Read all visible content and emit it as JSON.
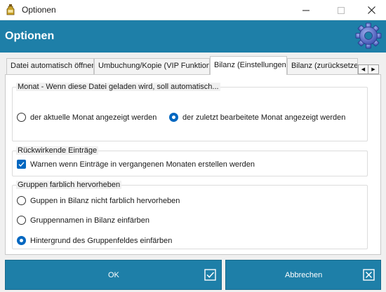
{
  "window": {
    "title": "Optionen",
    "icon": "app-bottle-icon",
    "controls": [
      "minimize-icon",
      "maximize-icon",
      "close-icon"
    ]
  },
  "header": {
    "title": "Optionen",
    "icon": "gear-icon"
  },
  "tabs": [
    {
      "label": "Datei automatisch öffnen",
      "active": false
    },
    {
      "label": "Umbuchung/Kopie (VIP Funktion)",
      "active": false
    },
    {
      "label": "Bilanz (Einstellungen)",
      "active": true
    },
    {
      "label": "Bilanz (zurücksetzen)",
      "active": false
    }
  ],
  "tab_scroll": {
    "left": "◀",
    "right": "▶"
  },
  "groups": {
    "monat": {
      "title": "Monat - Wenn diese Datei geladen wird, soll automatisch...",
      "options": [
        {
          "label": "der aktuelle Monat angezeigt werden",
          "checked": false
        },
        {
          "label": "der zuletzt bearbeitete Monat angezeigt werden",
          "checked": true
        }
      ]
    },
    "rueckwirkend": {
      "title": "Rückwirkende Einträge",
      "checkbox": {
        "label": "Warnen wenn Einträge in vergangenen Monaten erstellen werden",
        "checked": true
      }
    },
    "gruppen": {
      "title": "Gruppen farblich hervorheben",
      "options": [
        {
          "label": "Guppen in Bilanz nicht farblich hervorheben",
          "checked": false
        },
        {
          "label": "Gruppennamen in Bilanz einfärben",
          "checked": false
        },
        {
          "label": "Hintergrund des Gruppenfeldes einfärben",
          "checked": true
        }
      ]
    }
  },
  "buttons": {
    "ok": {
      "label": "OK",
      "icon": "checkbox-check-icon"
    },
    "cancel": {
      "label": "Abbrechen",
      "icon": "checkbox-x-icon"
    }
  },
  "colors": {
    "accent": "#1e7fa8",
    "radio_checked": "#0067c0"
  }
}
